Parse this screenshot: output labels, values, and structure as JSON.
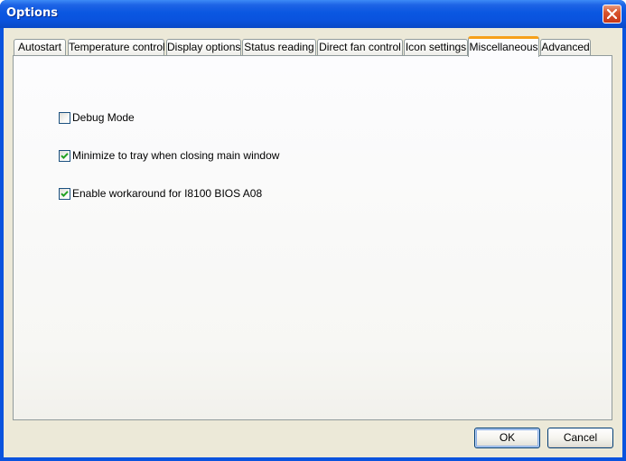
{
  "window": {
    "title": "Options"
  },
  "tabs": [
    {
      "label": "Autostart",
      "active": false
    },
    {
      "label": "Temperature control",
      "active": false
    },
    {
      "label": "Display options",
      "active": false
    },
    {
      "label": "Status reading",
      "active": false
    },
    {
      "label": "Direct fan control",
      "active": false
    },
    {
      "label": "Icon settings",
      "active": false
    },
    {
      "label": "Miscellaneous",
      "active": true
    },
    {
      "label": "Advanced",
      "active": false
    }
  ],
  "options": [
    {
      "label": "Debug Mode",
      "checked": false
    },
    {
      "label": "Minimize to tray when closing main window",
      "checked": true
    },
    {
      "label": "Enable workaround for I8100 BIOS A08",
      "checked": true
    }
  ],
  "buttons": {
    "ok_label": "OK",
    "cancel_label": "Cancel"
  },
  "colors": {
    "titlebar": "#0a53de",
    "active_tab_accent": "#f6a01a",
    "check_mark": "#21a121"
  }
}
